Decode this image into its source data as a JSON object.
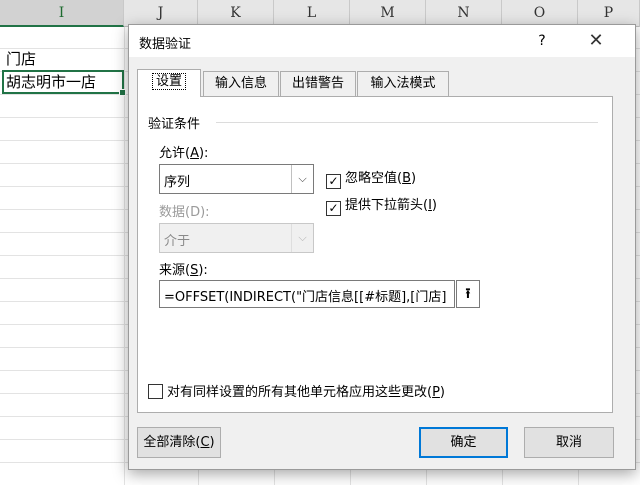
{
  "spreadsheet": {
    "columns": [
      {
        "name": "I",
        "selected": true
      },
      {
        "name": "J",
        "selected": false
      },
      {
        "name": "K",
        "selected": false
      },
      {
        "name": "L",
        "selected": false
      },
      {
        "name": "M",
        "selected": false
      },
      {
        "name": "N",
        "selected": false
      },
      {
        "name": "O",
        "selected": false
      },
      {
        "name": "P",
        "selected": false
      }
    ],
    "cells": {
      "header": "门店",
      "active": "胡志明市一店"
    }
  },
  "dialog": {
    "title": "数据验证",
    "help": "?",
    "close_icon": "close-icon",
    "tabs": [
      "设置",
      "输入信息",
      "出错警告",
      "输入法模式"
    ],
    "active_tab": "设置",
    "section_title": "验证条件",
    "allow": {
      "label": "允许(",
      "accel": "A",
      "label_end": "):",
      "value": "序列"
    },
    "data": {
      "label": "数据(D):",
      "value": "介于"
    },
    "ignore_blank": {
      "label": "忽略空值(",
      "accel": "B",
      "label_end": ")",
      "checked": true
    },
    "dropdown": {
      "label": "提供下拉箭头(",
      "accel": "I",
      "label_end": ")",
      "checked": true
    },
    "source": {
      "label": "来源(",
      "accel": "S",
      "label_end": "):",
      "value": "=OFFSET(INDIRECT(\"门店信息[[#标题],[门店]",
      "button_icon": "collapse-range-icon"
    },
    "apply_all": {
      "label": "对有同样设置的所有其他单元格应用这些更改(",
      "accel": "P",
      "label_end": ")",
      "checked": false
    },
    "buttons": {
      "clear": {
        "label": "全部清除(",
        "accel": "C",
        "label_end": ")"
      },
      "ok": "确定",
      "cancel": "取消"
    }
  },
  "colors": {
    "accent": "#217346",
    "focus_border": "#0078d7"
  }
}
